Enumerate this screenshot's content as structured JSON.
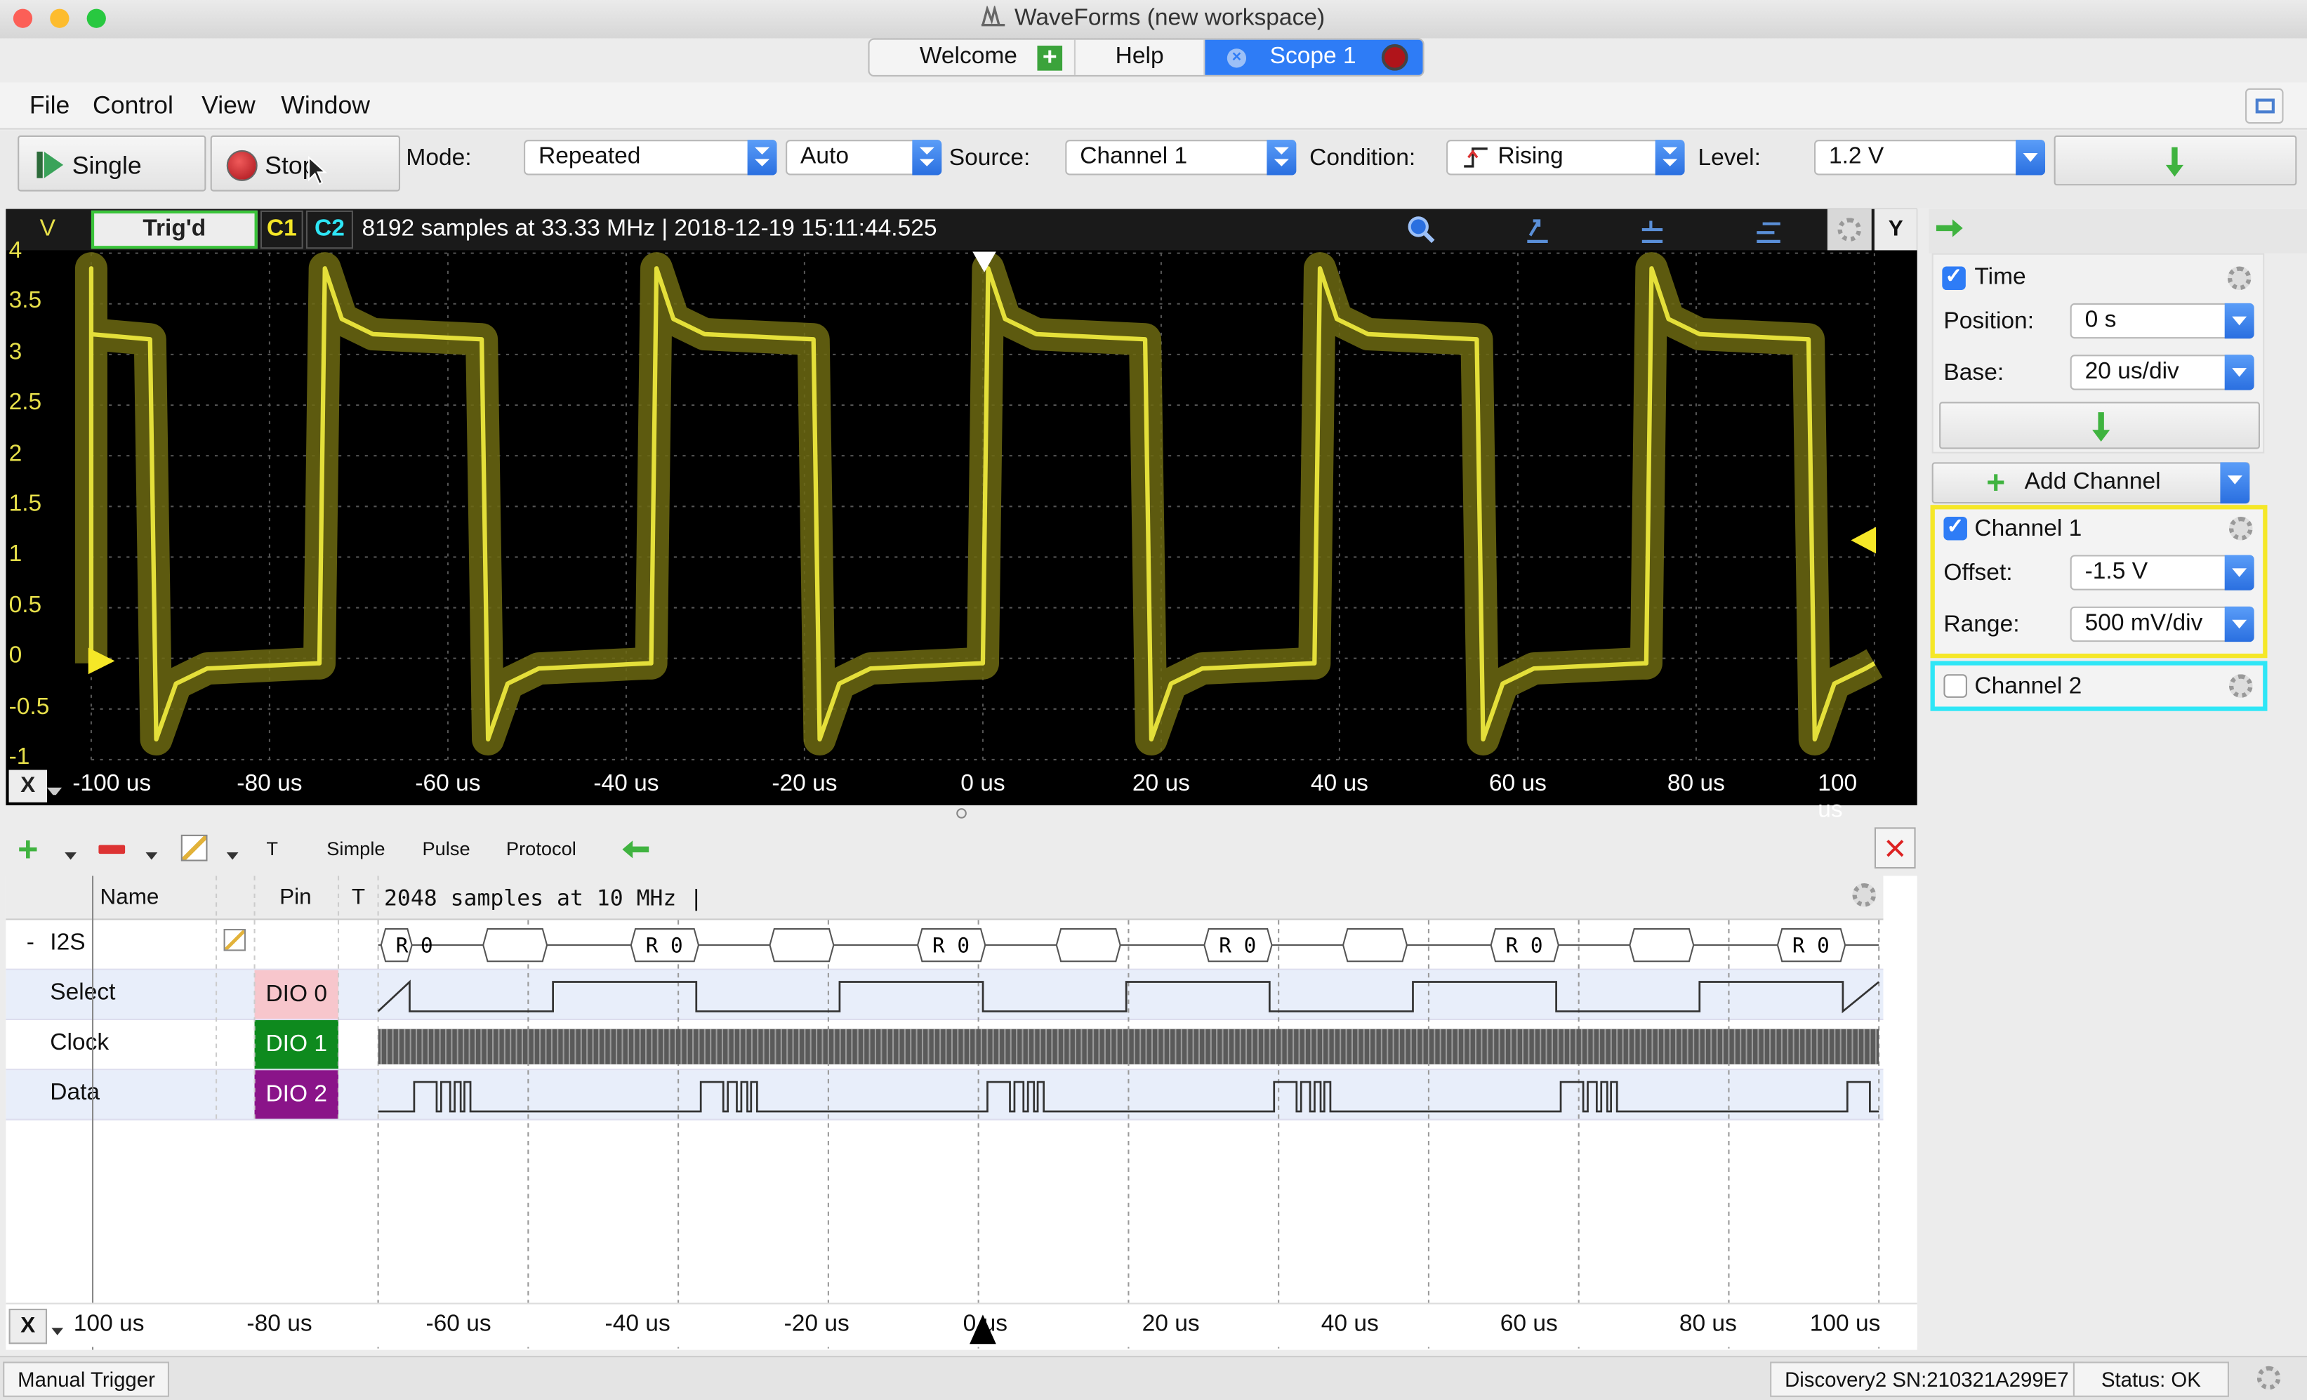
{
  "window": {
    "title": "WaveForms  (new workspace)"
  },
  "tabs": [
    {
      "label": "Welcome"
    },
    {
      "label": "Help"
    },
    {
      "label": "Scope 1"
    }
  ],
  "menu": [
    "File",
    "Control",
    "View",
    "Window"
  ],
  "toolbar": {
    "single_label": "Single",
    "stop_label": "Stop",
    "mode_label": "Mode:",
    "mode_value": "Repeated",
    "auto_value": "Auto",
    "source_label": "Source:",
    "source_value": "Channel 1",
    "condition_label": "Condition:",
    "condition_value": "Rising",
    "level_label": "Level:",
    "level_value": "1.2 V"
  },
  "scope": {
    "unit_label": "V",
    "status": "Trig'd",
    "c1": "C1",
    "c2": "C2",
    "info": "8192 samples at 33.33 MHz | 2018-12-19 15:11:44.525",
    "y_ticks": [
      "4",
      "3.5",
      "3",
      "2.5",
      "2",
      "1.5",
      "1",
      "0.5",
      "0",
      "-0.5",
      "-1"
    ],
    "x_ticks": [
      "-100 us",
      "-80 us",
      "-60 us",
      "-40 us",
      "-20 us",
      "0 us",
      "20 us",
      "40 us",
      "60 us",
      "80 us",
      "100 us"
    ],
    "x_button": "X",
    "y_button": "Y"
  },
  "panel": {
    "time_label": "Time",
    "position_label": "Position:",
    "position_value": "0 s",
    "base_label": "Base:",
    "base_value": "20 us/div",
    "add_channel": "Add Channel",
    "ch1_label": "Channel 1",
    "offset_label": "Offset:",
    "offset_value": "-1.5 V",
    "range_label": "Range:",
    "range_value": "500 mV/div",
    "ch2_label": "Channel 2",
    "ch1_color": "#f5e727",
    "ch2_color": "#2ee6f6"
  },
  "logic": {
    "toolbar": [
      "T",
      "Simple",
      "Pulse",
      "Protocol"
    ],
    "col_name": "Name",
    "col_pin": "Pin",
    "col_t": "T",
    "info": "2048 samples at 10 MHz |",
    "group": {
      "toggle": "-",
      "name": "I2S"
    },
    "signals": [
      {
        "name": "Select",
        "pin": "DIO  0",
        "color": "#f7c6cc"
      },
      {
        "name": "Clock",
        "pin": "DIO  1",
        "color": "#0e8a1e"
      },
      {
        "name": "Data",
        "pin": "DIO  2",
        "color": "#8a1489"
      }
    ],
    "bus_label": "R 0",
    "x_ticks": [
      "100 us",
      "-80 us",
      "-60 us",
      "-40 us",
      "-20 us",
      "0 us",
      "20 us",
      "40 us",
      "60 us",
      "80 us",
      "100 us"
    ],
    "x_button": "X"
  },
  "status": {
    "manual_trigger": "Manual Trigger",
    "device": "Discovery2 SN:210321A299E7",
    "status": "Status: OK"
  }
}
